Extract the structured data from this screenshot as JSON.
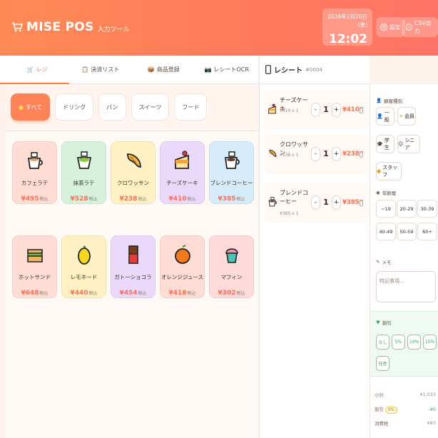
{
  "app": {
    "title": "MISE POS",
    "subtitle": "入力ツール"
  },
  "clock": {
    "date": "2026年2月20日 (金)",
    "time": "12:02"
  },
  "header_buttons": {
    "settings": "設定",
    "csv": "CSV出力"
  },
  "tabs": [
    {
      "label": "レジ",
      "active": true
    },
    {
      "label": "決済リスト",
      "active": false
    },
    {
      "label": "商品登録",
      "active": false
    },
    {
      "label": "レシートOCR",
      "active": false
    }
  ],
  "categories": [
    {
      "label": "すべて",
      "active": true
    },
    {
      "label": "ドリンク",
      "active": false
    },
    {
      "label": "パン",
      "active": false
    },
    {
      "label": "スイーツ",
      "active": false
    },
    {
      "label": "フード",
      "active": false
    }
  ],
  "tax_label": "税込",
  "products": [
    {
      "name": "カフェラテ",
      "price": "¥495",
      "color": "#ffddd4",
      "icon": "latte-icon"
    },
    {
      "name": "抹茶ラテ",
      "price": "¥528",
      "color": "#d6f2dd",
      "icon": "matcha-icon"
    },
    {
      "name": "クロワッサン",
      "price": "¥238",
      "color": "#fff1c4",
      "icon": "croissant-icon"
    },
    {
      "name": "チーズケーキ",
      "price": "¥410",
      "color": "#ead9fb",
      "icon": "cheesecake-icon"
    },
    {
      "name": "ブレンドコーヒー",
      "price": "¥385",
      "color": "#d6ecfb",
      "icon": "coffee-icon"
    },
    {
      "name": "ホットサンド",
      "price": "¥648",
      "color": "#ffddd4",
      "icon": "sandwich-icon"
    },
    {
      "name": "レモネード",
      "price": "¥440",
      "color": "#fff1c4",
      "icon": "lemon-icon"
    },
    {
      "name": "ガトーショコラ",
      "price": "¥454",
      "color": "#ead9fb",
      "icon": "chocolate-icon"
    },
    {
      "name": "オレンジジュース",
      "price": "¥418",
      "color": "#ffddd4",
      "icon": "orange-icon"
    },
    {
      "name": "マフィン",
      "price": "¥302",
      "color": "#ffdadb",
      "icon": "muffin-icon"
    }
  ],
  "receipt": {
    "title": "レシート",
    "number": "#0004",
    "items": [
      {
        "name": "チーズケーキ",
        "unit": "¥410 x 1",
        "qty": "1",
        "price": "¥410",
        "icon": "cheesecake-icon"
      },
      {
        "name": "クロワッサン",
        "unit": "¥238 x 1",
        "qty": "1",
        "price": "¥238",
        "icon": "croissant-icon"
      },
      {
        "name": "ブレンドコーヒー",
        "unit": "¥385 x 1",
        "qty": "1",
        "price": "¥385",
        "icon": "coffee-icon"
      }
    ],
    "minus": "-",
    "plus": "+"
  },
  "customer": {
    "type_label": "顧客種別",
    "types": [
      "一般",
      "会員",
      "学生",
      "シニア",
      "スタッフ"
    ],
    "age_label": "年齢層",
    "ages": [
      "~19",
      "20-29",
      "30-39",
      "40-49",
      "50-59",
      "60+"
    ],
    "memo_label": "メモ",
    "memo_placeholder": "特記事項...",
    "discount_label": "割引",
    "discounts": [
      "なし",
      "5%",
      "10%",
      "15%",
      "任意"
    ]
  },
  "summary": {
    "subtotal_label": "小計",
    "subtotal": "¥1,033",
    "discount_label": "割引",
    "discount_pct": "0%",
    "discount": "-¥0",
    "tax_label": "消費税",
    "tax": "¥83"
  },
  "colors": {
    "accent": "#ff7a45",
    "price": "#ff6f54",
    "discount": "#3aa35f"
  }
}
